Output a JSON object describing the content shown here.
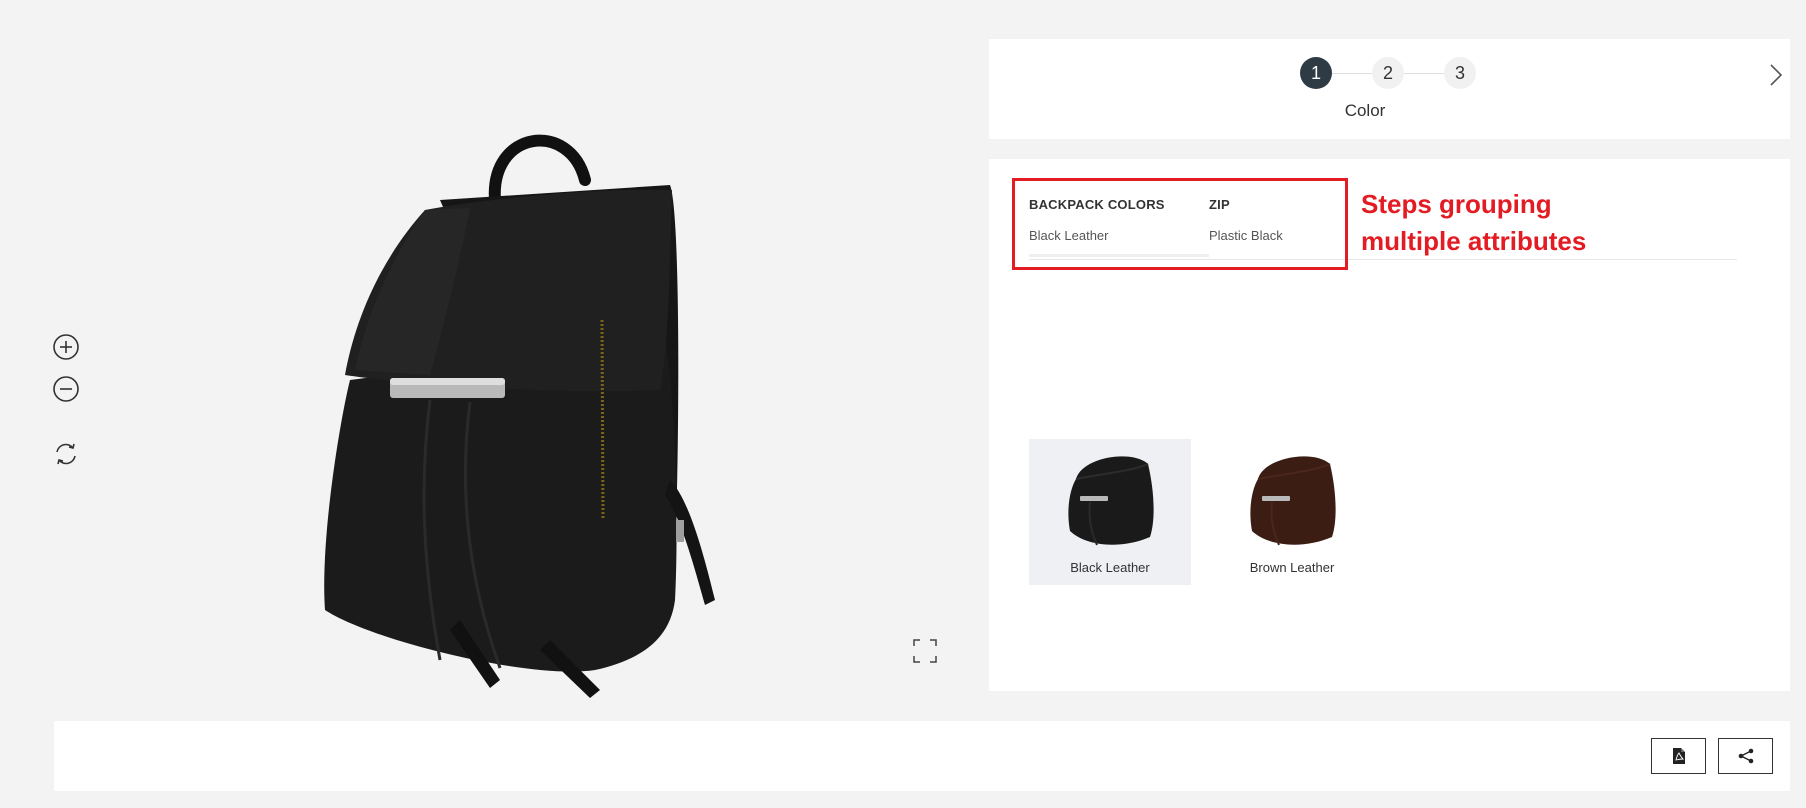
{
  "viewer": {
    "tools": [
      {
        "name": "zoom-in",
        "icon": "plus-circle-icon"
      },
      {
        "name": "zoom-out",
        "icon": "minus-circle-icon"
      },
      {
        "name": "rotate",
        "icon": "rotate-icon"
      }
    ],
    "fullscreen_icon": "fullscreen-icon"
  },
  "stepper": {
    "steps": [
      "1",
      "2",
      "3"
    ],
    "active_step": 1,
    "current_label": "Color",
    "next_icon": "chevron-right-icon"
  },
  "attributes": [
    {
      "name": "BACKPACK COLORS",
      "value": "Black Leather"
    },
    {
      "name": "ZIP",
      "value": "Plastic Black"
    }
  ],
  "annotation": {
    "line1": "Steps grouping",
    "line2": "multiple attributes",
    "color": "#e31b23"
  },
  "swatches": [
    {
      "label": "Black Leather",
      "selected": true,
      "color": "#1a1a1a"
    },
    {
      "label": "Brown Leather",
      "selected": false,
      "color": "#3b1d14"
    }
  ],
  "bottom_bar": {
    "buttons": [
      {
        "name": "pdf-export",
        "icon": "pdf-icon"
      },
      {
        "name": "share",
        "icon": "share-icon"
      }
    ]
  },
  "colors": {
    "background": "#f3f3f3",
    "panel": "#ffffff",
    "step_active": "#2e3a44",
    "step_inactive": "#f1f1f1"
  }
}
